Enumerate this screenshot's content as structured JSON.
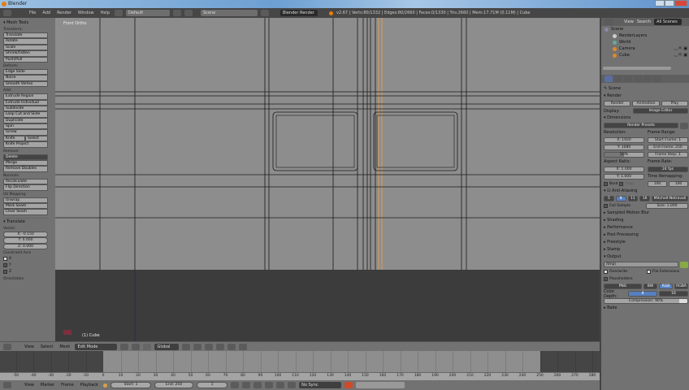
{
  "window": {
    "title": "Blender"
  },
  "info_header": {
    "menus": [
      "File",
      "Add",
      "Render",
      "Window",
      "Help"
    ],
    "layout": "Default",
    "scene": "Scene",
    "engine": "Blender Render",
    "stats": "v2.67 | Verts:80/1332 | Edges:80/2660 | Faces:0/1330 | Tris:2660 | Mem:17.71M (0.11M) | Cube"
  },
  "toolbar": {
    "title": "Mesh Tools",
    "groups": [
      {
        "label": "Transform:",
        "buttons": [
          "Translate",
          "Rotate",
          "Scale",
          "Shrink/Fatten",
          "Push/Pull"
        ]
      },
      {
        "label": "Deform:",
        "buttons": [
          "Edge Slide",
          "Noise",
          "Smooth Vertex"
        ]
      },
      {
        "label": "Add:",
        "buttons": [
          "Extrude Region",
          "Extrude Individual",
          "Subdivide",
          "Loop Cut and Slide",
          "Duplicate",
          "Spin",
          "Screw"
        ]
      }
    ],
    "knife": "Knife",
    "select": "Select",
    "knife_project": "Knife Project",
    "remove_label": "Remove:",
    "delete": "Delete",
    "merge": "Merge",
    "remove_doubles": "Remove Doubles",
    "normals_label": "Normals:",
    "recalculate": "Recalculate",
    "flip_direction": "Flip Direction",
    "uv_label": "UV Mapping:",
    "unwrap": "Unwrap",
    "mark_seam": "Mark Seam",
    "clear_seam": "Clear Seam",
    "operator_title": "Translate",
    "vector_label": "Vector",
    "vector": [
      "X: -0.150",
      "Y: 0.000",
      "Z: 0.000"
    ],
    "constraint_label": "Constraint Axis",
    "axes": [
      {
        "label": "X",
        "checked": true
      },
      {
        "label": "Y",
        "checked": false
      },
      {
        "label": "Z",
        "checked": false
      }
    ],
    "orientation_label": "Orientation"
  },
  "viewport": {
    "view_label": "Front Ortho",
    "object_label": "(1) Cube",
    "colors": {
      "top": "#8d8d8d",
      "bottom": "#3c3c3c",
      "edge": "#1a1a1a",
      "selected_edge": "#f0a040"
    }
  },
  "view3d_header": {
    "menus": [
      "View",
      "Select",
      "Mesh"
    ],
    "mode": "Edit Mode",
    "orientation": "Global"
  },
  "timeline": {
    "ticks": [
      -50,
      -40,
      -30,
      -20,
      -10,
      0,
      10,
      20,
      30,
      40,
      50,
      60,
      70,
      80,
      90,
      100,
      110,
      120,
      130,
      140,
      150,
      160,
      170,
      180,
      190,
      200,
      210,
      220,
      230,
      240,
      250,
      260,
      270,
      280
    ],
    "current_frame": 0,
    "start": 0,
    "end": 250
  },
  "timeline_header": {
    "menus": [
      "View",
      "Marker",
      "Frame",
      "Playback"
    ],
    "start": "Start: 1",
    "end": "End: 250",
    "frame": "1",
    "sync": "No Sync"
  },
  "outliner": {
    "menus": [
      "View",
      "Search"
    ],
    "filter": "All Scenes",
    "items": [
      "Scene",
      "RenderLayers",
      "World",
      "Camera",
      "Cube"
    ]
  },
  "properties": {
    "context": "Scene",
    "render": {
      "title": "Render",
      "buttons": [
        "Render",
        "Animation",
        "Play"
      ],
      "display_label": "Display:",
      "display": "Image Editor"
    },
    "dimensions": {
      "title": "Dimensions",
      "presets": "Render Presets",
      "resolution_label": "Resolution:",
      "res_x": "X: 1920",
      "res_y": "Y: 1080",
      "res_pct": "50%",
      "res_pct_value": 50,
      "frame_range_label": "Frame Range:",
      "start": "Start Frame: 1",
      "end": "End Frame: 250",
      "step": "Frame Step: 1",
      "aspect_label": "Aspect Ratio:",
      "asp_x": "X: 1.000",
      "asp_y": "Y: 1.000",
      "border": "Bord",
      "crop": "Crop",
      "frame_rate_label": "Frame Rate:",
      "fps": "24 fps",
      "remap_label": "Time Remapping:",
      "remap_old": "100",
      "remap_new": "100"
    },
    "aa": {
      "title": "Anti-Aliasing",
      "samples": [
        "5",
        "8",
        "11",
        "16"
      ],
      "selected": "8",
      "filter": "Mitchell-Netravali",
      "full_sample": "Full Sample",
      "size": "Size: 1.000"
    },
    "collapsed": [
      "Sampled Motion Blur",
      "Shading",
      "Performance",
      "Post Processing",
      "Freestyle",
      "Stamp"
    ],
    "output": {
      "title": "Output",
      "path": "/tmp\\",
      "overwrite": "Overwrite",
      "file_ext": "File Extensions",
      "placeholders": "Placeholders",
      "format": "PNG",
      "modes": [
        "BW",
        "RGB",
        "RGBA"
      ],
      "mode_selected": "RGB",
      "depth_label": "Color Depth:",
      "depths": [
        "8",
        "16"
      ],
      "depth_selected": "8",
      "compression": "Compression: 90%",
      "compression_value": 90
    },
    "bake": "Bake"
  }
}
